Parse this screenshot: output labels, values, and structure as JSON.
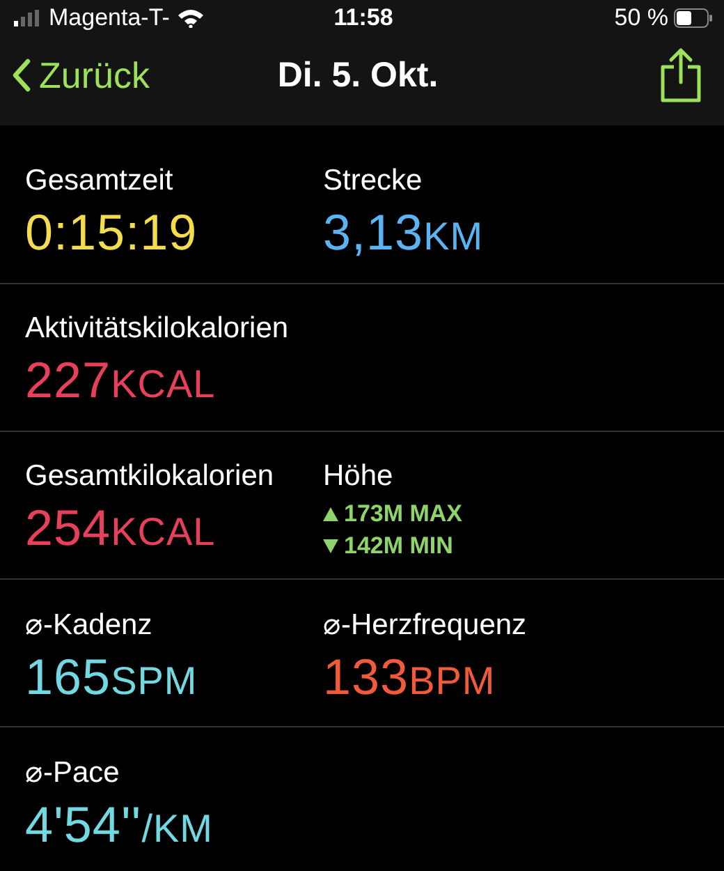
{
  "status_bar": {
    "carrier": "Magenta-T-",
    "time": "11:58",
    "battery": "50 %"
  },
  "nav": {
    "back": "Zurück",
    "title": "Di. 5. Okt."
  },
  "rows": [
    {
      "cells": [
        {
          "kind": "metric",
          "label": "Gesamtzeit",
          "value": "0:15:19",
          "color": "#f3dd4c"
        },
        {
          "kind": "metric",
          "label": "Strecke",
          "value": "3,13",
          "unit": "KM",
          "color": "#5ab4f2"
        }
      ]
    },
    {
      "cells": [
        {
          "kind": "metric",
          "label": "Aktivitätskilokalorien",
          "value": "227",
          "unit": "KCAL",
          "color": "#e8405a"
        }
      ]
    },
    {
      "cells": [
        {
          "kind": "metric",
          "label": "Gesamtkilokalorien",
          "value": "254",
          "unit": "KCAL",
          "color": "#e8405a"
        },
        {
          "kind": "elevation",
          "label": "Höhe",
          "lines": [
            {
              "kind": "max",
              "text": "173M MAX"
            },
            {
              "kind": "min",
              "text": "142M MIN"
            }
          ],
          "color": "#8fd46a"
        }
      ]
    },
    {
      "cells": [
        {
          "kind": "metric",
          "label": "⌀-Kadenz",
          "value": "165",
          "unit": "SPM",
          "color": "#72d8e2"
        },
        {
          "kind": "metric",
          "label": "⌀-Herzfrequenz",
          "value": "133",
          "unit": "BPM",
          "color": "#f25a3c"
        }
      ]
    },
    {
      "cells": [
        {
          "kind": "metric",
          "label": "⌀-Pace",
          "value": "4'54''",
          "unit": "/KM",
          "color": "#72d8e2"
        }
      ]
    }
  ]
}
